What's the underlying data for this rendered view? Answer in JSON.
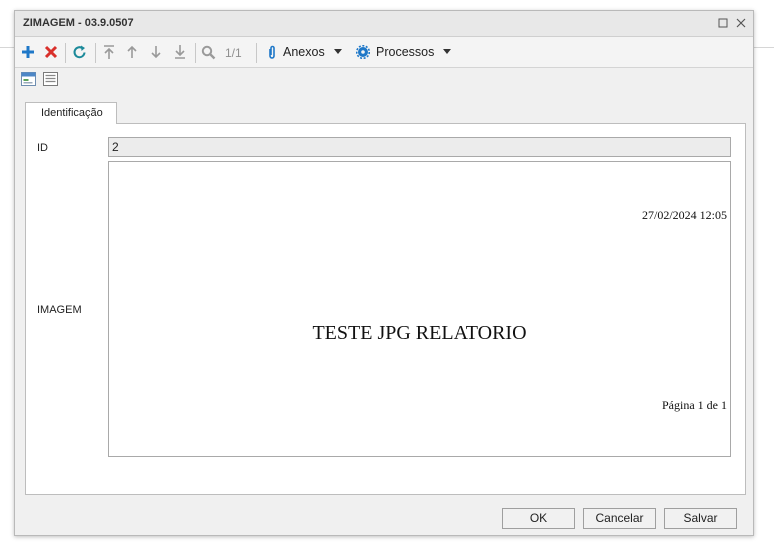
{
  "window": {
    "title": "ZIMAGEM - 03.9.0507"
  },
  "toolbar": {
    "page_count": "1/1",
    "attachments_label": "Anexos",
    "processes_label": "Processos"
  },
  "tabs": [
    {
      "label": "Identificação"
    }
  ],
  "form": {
    "id_label": "ID",
    "id_value": "2",
    "image_label": "IMAGEM",
    "image_content": {
      "date": "27/02/2024 12:05",
      "title": "TESTE JPG RELATORIO",
      "page": "Página 1 de 1"
    }
  },
  "footer": {
    "ok_label": "OK",
    "cancel_label": "Cancelar",
    "save_label": "Salvar"
  },
  "colors": {
    "accent_blue": "#1f78c8",
    "delete_red": "#d9302b",
    "refresh_teal": "#1c8a9a"
  }
}
